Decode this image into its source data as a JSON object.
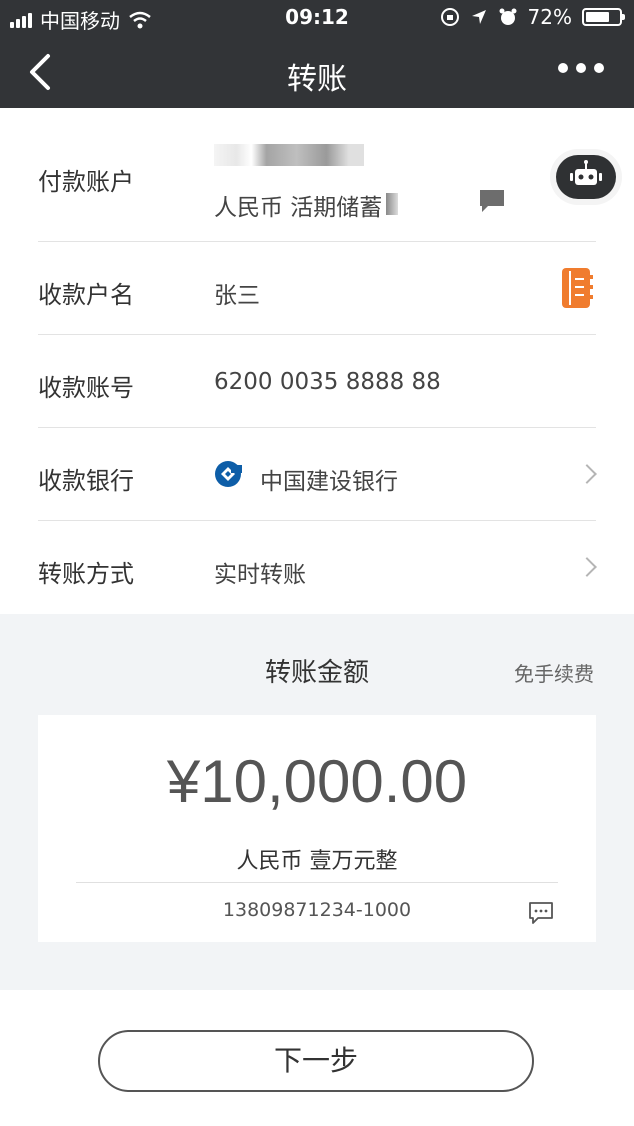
{
  "status_bar": {
    "carrier": "中国移动",
    "time": "09:12",
    "battery": "72%",
    "battery_level": 0.72
  },
  "nav": {
    "title": "转账",
    "back_icon": "chevron-left-icon",
    "more_icon": "more-dots-icon"
  },
  "form": {
    "payer": {
      "label": "付款账户",
      "account_type": "人民币 活期储蓄"
    },
    "payee_name": {
      "label": "收款户名",
      "value": "张三"
    },
    "payee_account": {
      "label": "收款账号",
      "value": "6200 0035 8888 88"
    },
    "payee_bank": {
      "label": "收款银行",
      "value": "中国建设银行"
    },
    "transfer_method": {
      "label": "转账方式",
      "value": "实时转账"
    }
  },
  "amount_section": {
    "title": "转账金额",
    "fee_note": "免手续费",
    "amount": "¥10,000.00",
    "amount_in_words": "人民币 壹万元整",
    "memo": "13809871234-1000"
  },
  "actions": {
    "next_label": "下一步"
  },
  "colors": {
    "header_bg": "#323437",
    "accent_orange": "#f07c2e",
    "ccb_blue": "#0e5ea8",
    "section_bg": "#f2f4f6"
  }
}
